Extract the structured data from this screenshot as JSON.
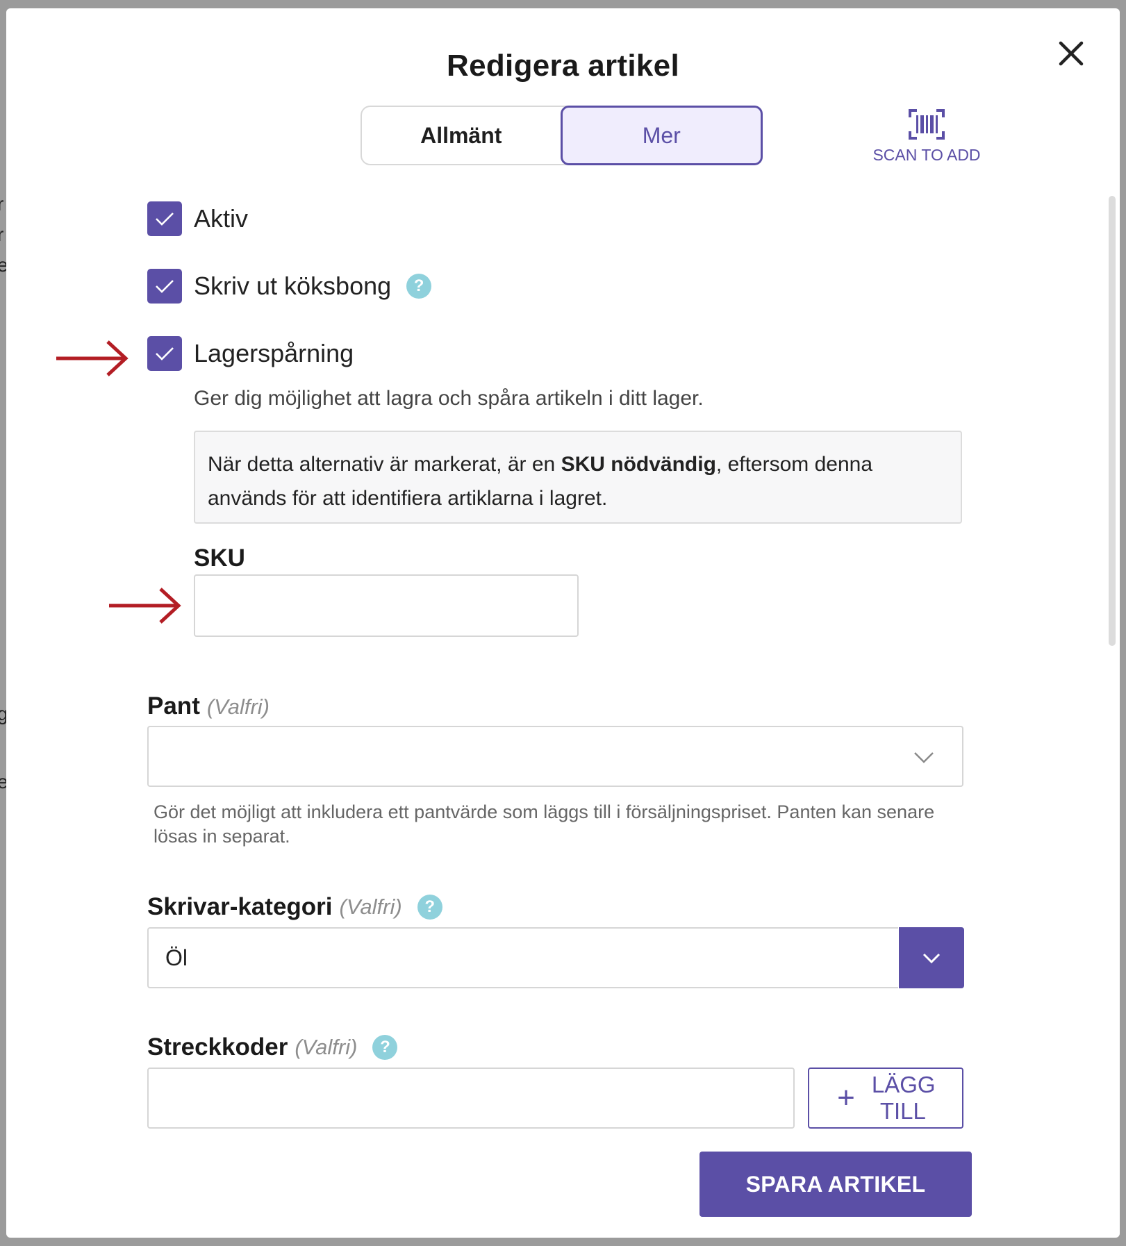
{
  "dialog": {
    "title": "Redigera artikel",
    "close_icon": "close-icon"
  },
  "tabs": [
    {
      "label": "Allmänt",
      "active": false
    },
    {
      "label": "Mer",
      "active": true
    }
  ],
  "scan": {
    "label": "SCAN TO ADD",
    "icon": "barcode-scan-icon"
  },
  "checkboxes": {
    "aktiv": {
      "label": "Aktiv",
      "checked": true
    },
    "kitchen": {
      "label": "Skriv ut köksbong",
      "checked": true
    },
    "stock": {
      "label": "Lagerspårning",
      "checked": true
    }
  },
  "stock_tracking": {
    "description": "Ger dig möjlighet att lagra och spåra artikeln i ditt lager.",
    "info_before": "När detta alternativ är markerat, är en ",
    "info_bold": "SKU nödvändig",
    "info_after": ", eftersom denna används för att identifiera artiklarna i lagret."
  },
  "sku": {
    "label": "SKU",
    "value": ""
  },
  "pant": {
    "label": "Pant",
    "optional": "(Valfri)",
    "selected": "",
    "hint": "Gör det möjligt att inkludera ett pantvärde som läggs till i försäljningspriset. Panten kan senare lösas in separat."
  },
  "printer_category": {
    "label": "Skrivar-kategori",
    "optional": "(Valfri)",
    "selected": "Öl"
  },
  "barcodes": {
    "label": "Streckkoder",
    "optional": "(Valfri)",
    "value": "",
    "add_line1": "LÄGG",
    "add_line2": "TILL",
    "add_symbol": "+"
  },
  "help_symbol": "?",
  "save_label": "SPARA ARTIKEL",
  "colors": {
    "accent": "#5b4fa6",
    "accent_light": "#f0edfd",
    "help": "#8fd1dc",
    "annotation_arrow": "#b31d24"
  },
  "background_fragments": [
    "r",
    "r",
    "er",
    "g",
    "e"
  ]
}
